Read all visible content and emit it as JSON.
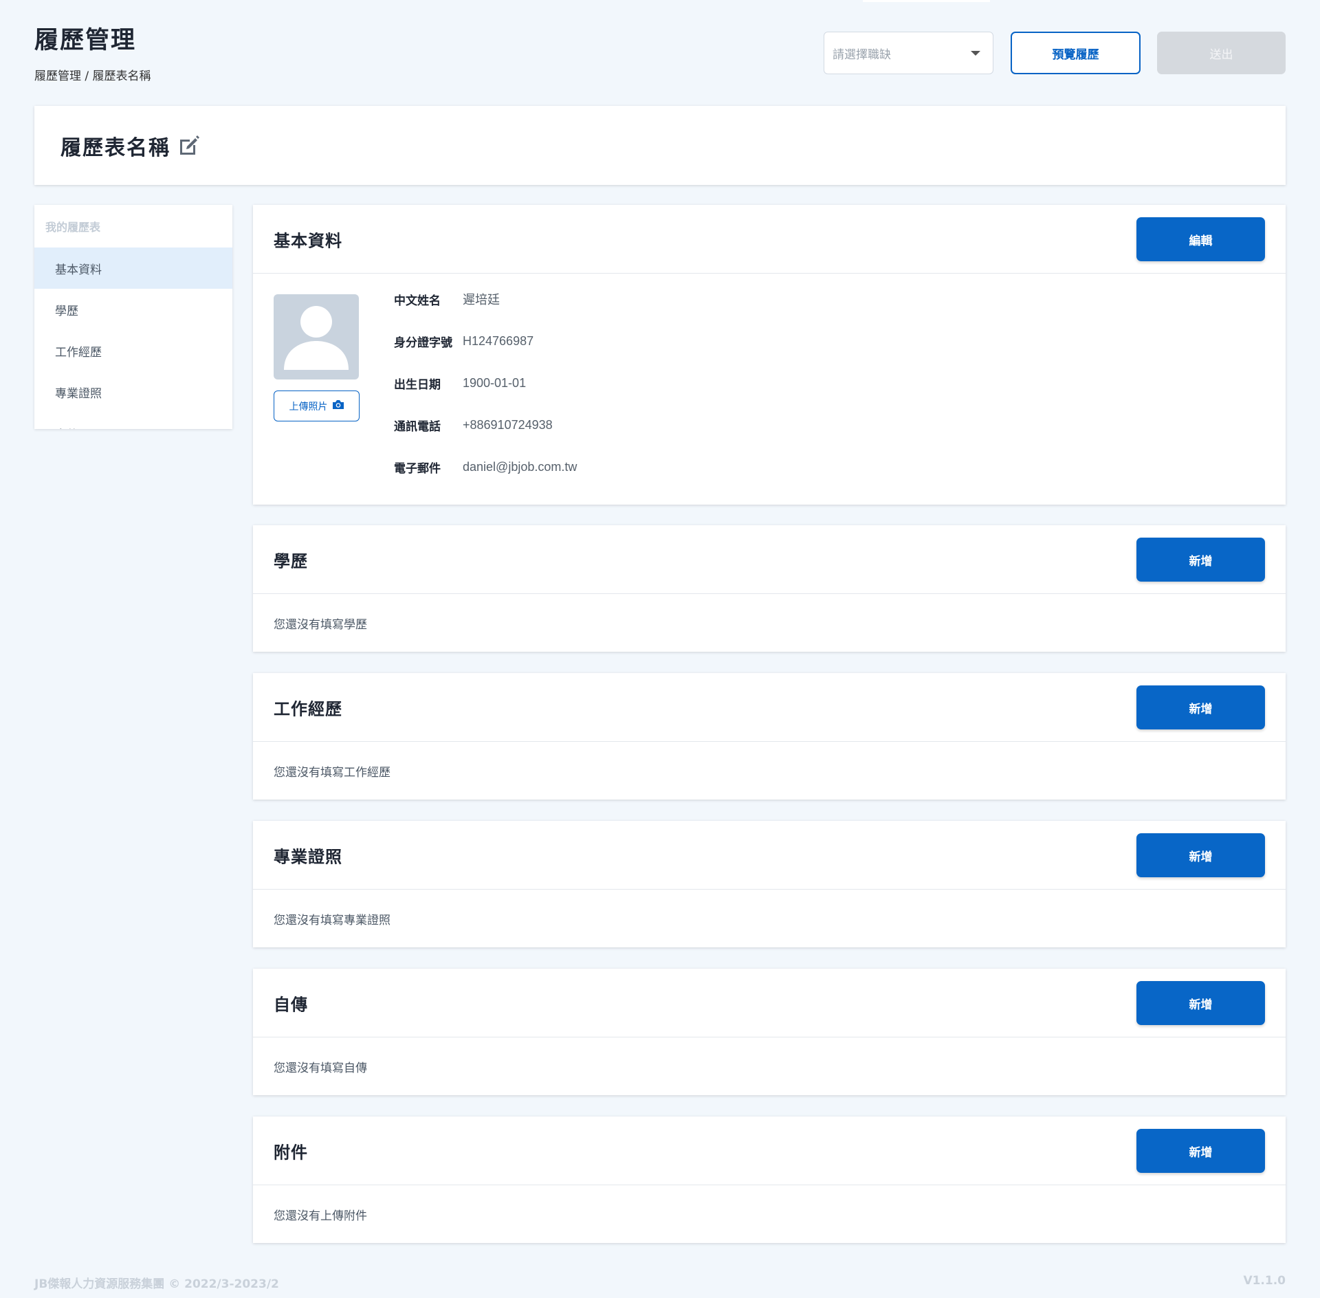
{
  "header": {
    "title": "履歷管理",
    "breadcrumb": [
      "履歷管理",
      "履歷表名稱"
    ],
    "breadcrumb_sep": "/",
    "job_select_placeholder": "請選擇職缺",
    "preview_label": "預覽履歷",
    "submit_label": "送出"
  },
  "resume_name": {
    "title": "履歷表名稱",
    "icon": "edit-icon"
  },
  "sidebar": {
    "heading": "我的履歷表",
    "items": [
      {
        "label": "基本資料",
        "active": true
      },
      {
        "label": "學歷",
        "active": false
      },
      {
        "label": "工作經歷",
        "active": false
      },
      {
        "label": "專業證照",
        "active": false
      },
      {
        "label": "自傳",
        "active": false
      }
    ]
  },
  "basic_info": {
    "title": "基本資料",
    "edit_label": "編輯",
    "upload_label": "上傳照片",
    "fields": [
      {
        "label": "中文姓名",
        "value": "遲培廷"
      },
      {
        "label": "身分證字號",
        "value": "H124766987"
      },
      {
        "label": "出生日期",
        "value": "1900-01-01"
      },
      {
        "label": "通訊電話",
        "value": "+886910724938"
      },
      {
        "label": "電子郵件",
        "value": "daniel@jbjob.com.tw"
      }
    ]
  },
  "sections": [
    {
      "title": "學歷",
      "button": "新增",
      "empty_text": "您還沒有填寫學歷"
    },
    {
      "title": "工作經歷",
      "button": "新增",
      "empty_text": "您還沒有填寫工作經歷"
    },
    {
      "title": "專業證照",
      "button": "新增",
      "empty_text": "您還沒有填寫專業證照"
    },
    {
      "title": "自傳",
      "button": "新增",
      "empty_text": "您還沒有填寫自傳"
    },
    {
      "title": "附件",
      "button": "新增",
      "empty_text": "您還沒有上傳附件"
    }
  ],
  "footer": {
    "copyright": "JB傑報人力資源服務集團 © 2022/3-2023/2",
    "version": "V1.1.0"
  },
  "colors": {
    "primary": "#0866c7",
    "background": "#f2f7fc",
    "sidebar_active": "#e1eefb",
    "disabled": "#d5d9de"
  }
}
